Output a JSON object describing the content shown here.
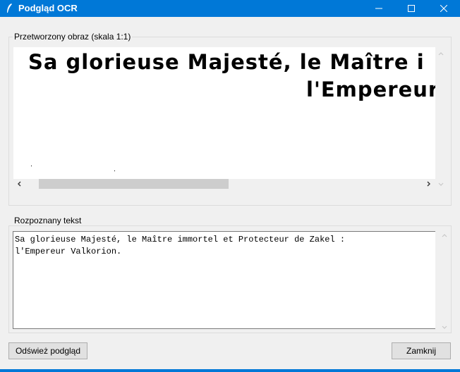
{
  "window": {
    "title": "Podgląd OCR"
  },
  "image_section": {
    "label": "Przetworzony obraz (skala 1:1)",
    "lines": [
      "Sa glorieuse Majesté, le Maître i",
      "l'Empereur"
    ]
  },
  "text_section": {
    "label": "Rozpoznany tekst",
    "lines": [
      "Sa glorieuse Majesté, le Maître immortel et Protecteur de Zakel :",
      "l'Empereur Valkorion."
    ]
  },
  "buttons": {
    "refresh": "Odśwież podgląd",
    "close": "Zamknij"
  },
  "colors": {
    "titlebar": "#0078d7"
  }
}
